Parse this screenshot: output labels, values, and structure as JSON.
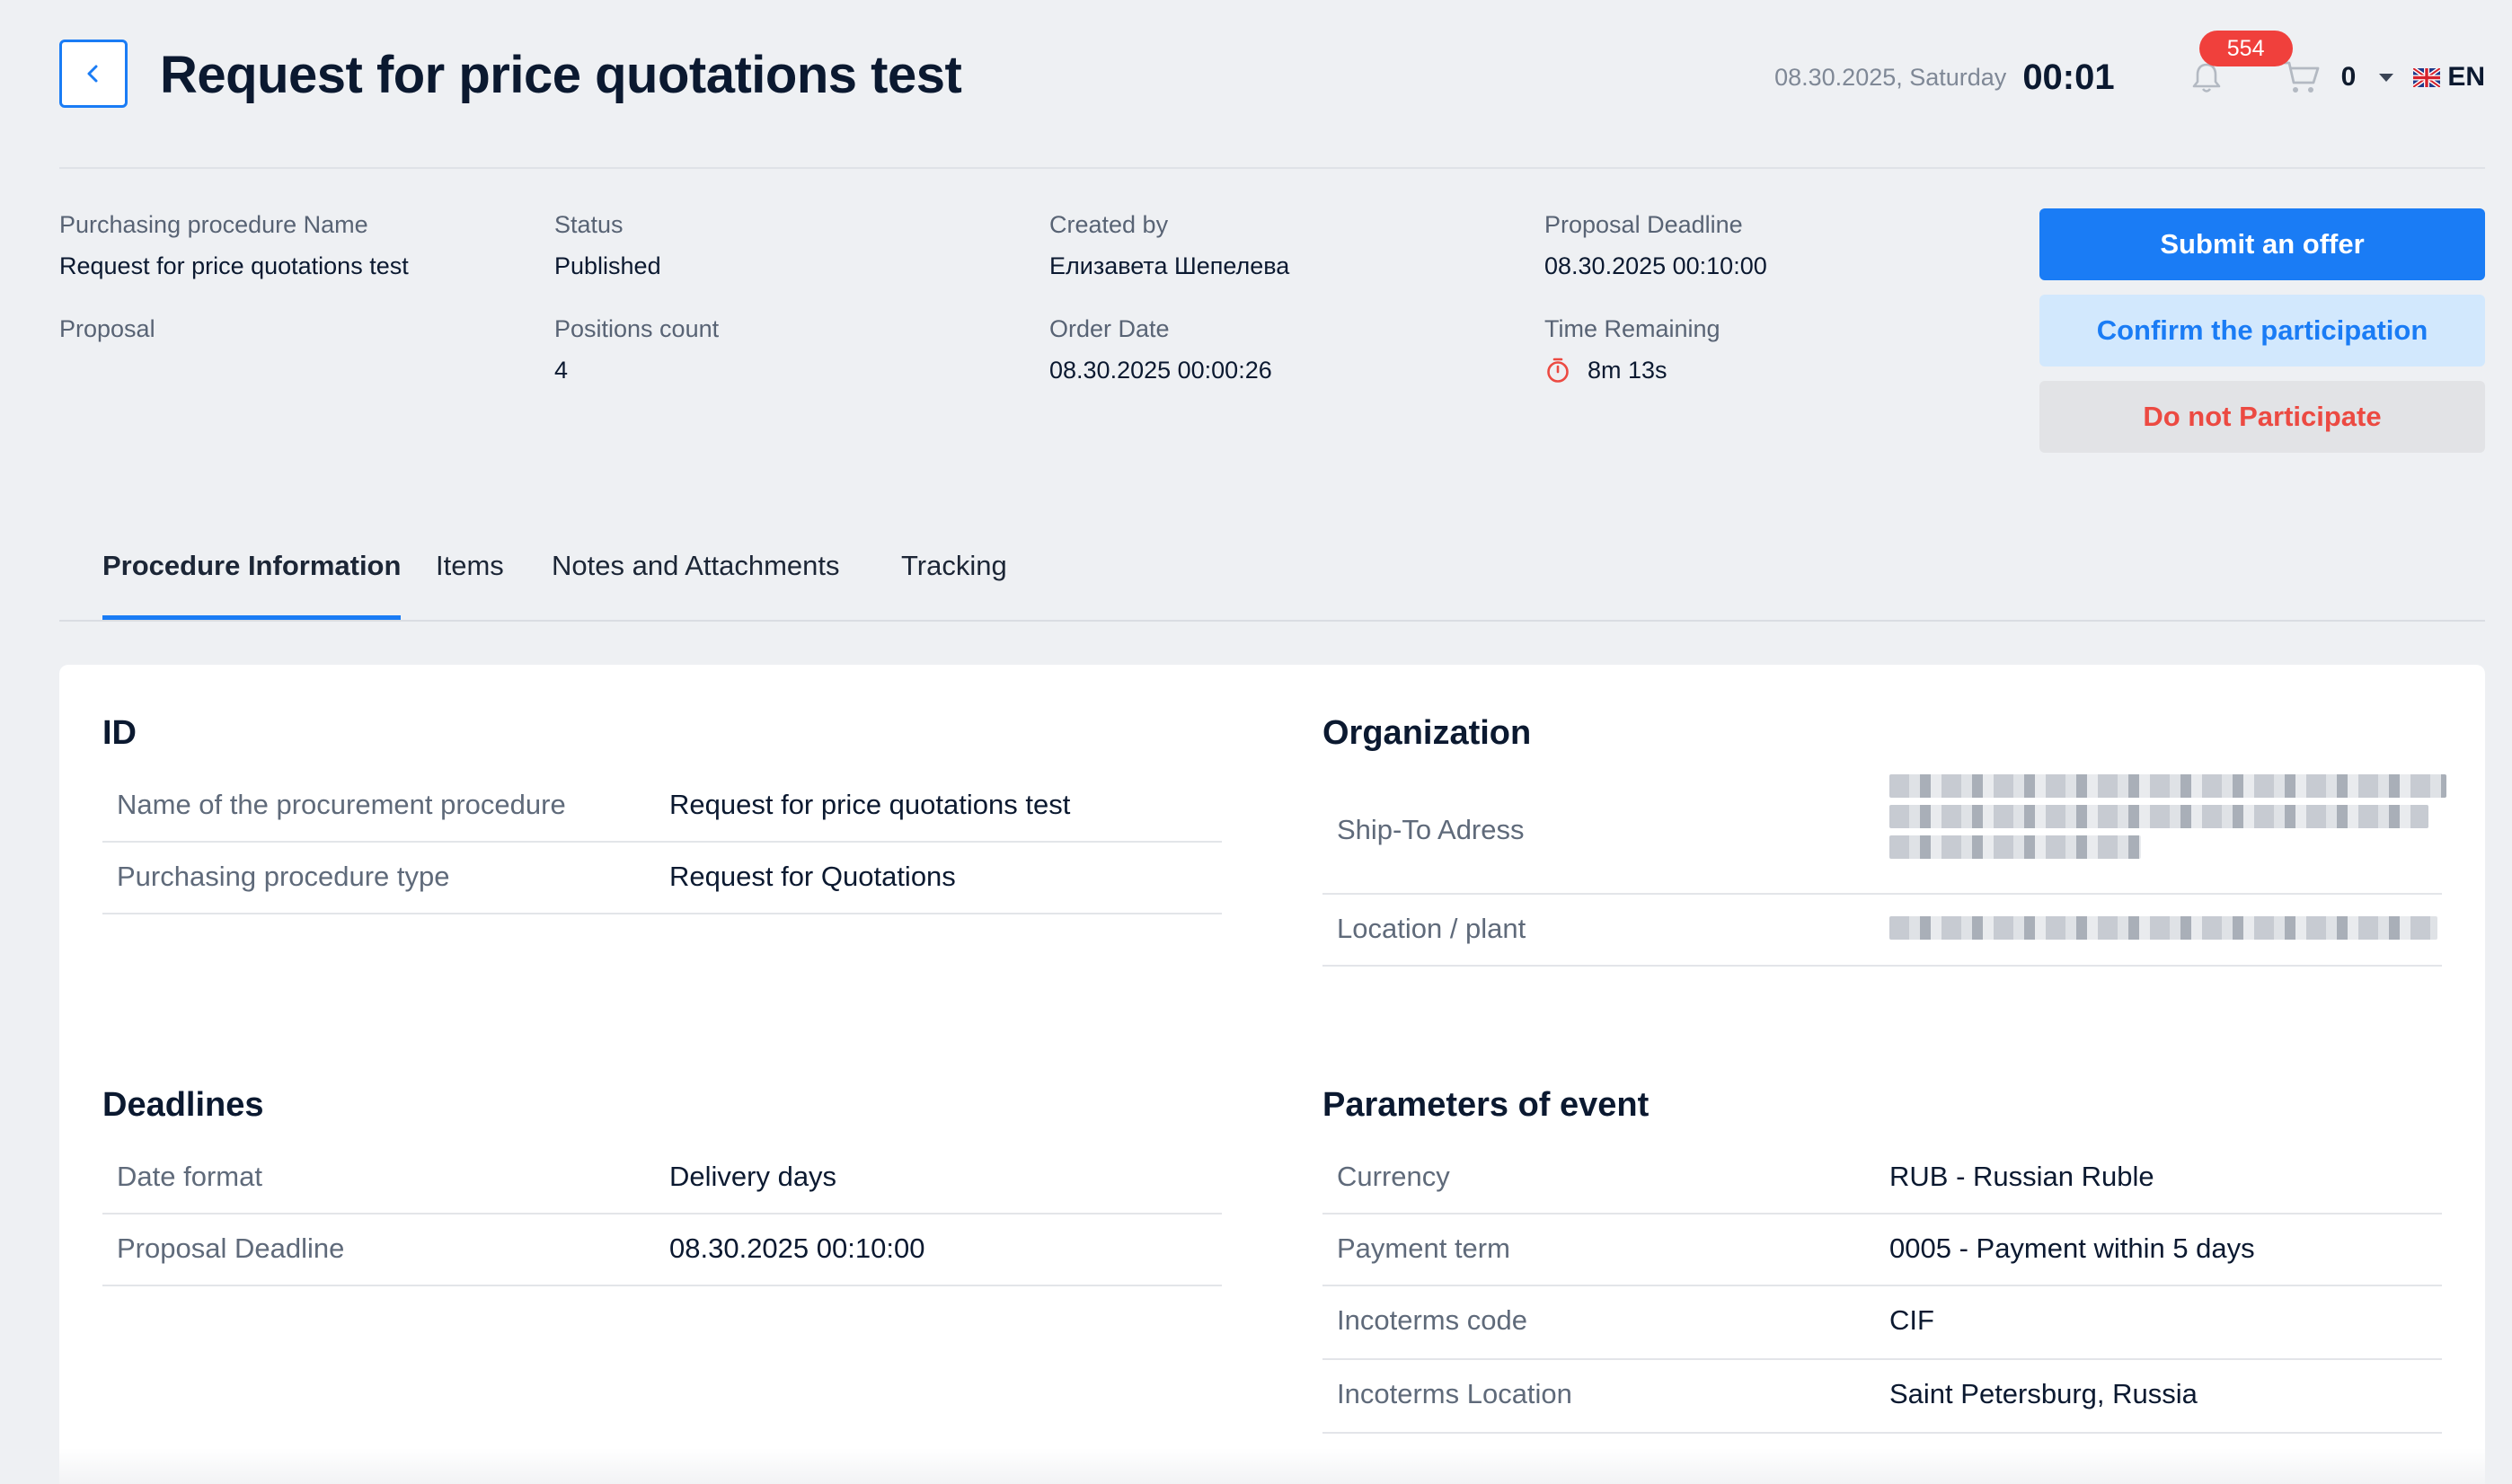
{
  "header": {
    "title": "Request for price quotations test",
    "date": "08.30.2025, Saturday",
    "time": "00:01",
    "notifications_count": "554",
    "cart_count": "0",
    "language": "EN"
  },
  "summary": {
    "procedure_name_label": "Purchasing procedure Name",
    "procedure_name_value": "Request for price quotations test",
    "status_label": "Status",
    "status_value": "Published",
    "created_by_label": "Created by",
    "created_by_value": "Елизавета Шепелева",
    "proposal_deadline_label": "Proposal Deadline",
    "proposal_deadline_value": "08.30.2025 00:10:00",
    "proposal_label": "Proposal",
    "positions_count_label": "Positions count",
    "positions_count_value": "4",
    "order_date_label": "Order Date",
    "order_date_value": "08.30.2025 00:00:26",
    "time_remaining_label": "Time Remaining",
    "time_remaining_value": "8m 13s"
  },
  "actions": {
    "submit_offer": "Submit an offer",
    "confirm_participation": "Confirm the participation",
    "do_not_participate": "Do not Participate"
  },
  "tabs": [
    {
      "label": "Procedure Information",
      "active": true
    },
    {
      "label": "Items",
      "active": false
    },
    {
      "label": "Notes and Attachments",
      "active": false
    },
    {
      "label": "Tracking",
      "active": false
    }
  ],
  "sections": {
    "id": {
      "title": "ID",
      "rows": [
        {
          "label": "Name of the procurement procedure",
          "value": "Request for price quotations test"
        },
        {
          "label": "Purchasing procedure type",
          "value": "Request for Quotations"
        }
      ]
    },
    "organization": {
      "title": "Organization",
      "rows": [
        {
          "label": "Ship-To Adress",
          "value": ""
        },
        {
          "label": "Location / plant",
          "value": ""
        }
      ]
    },
    "deadlines": {
      "title": "Deadlines",
      "rows": [
        {
          "label": "Date format",
          "value": "Delivery days"
        },
        {
          "label": "Proposal Deadline",
          "value": "08.30.2025 00:10:00"
        }
      ]
    },
    "parameters": {
      "title": "Parameters of event",
      "rows": [
        {
          "label": "Currency",
          "value": "RUB - Russian Ruble"
        },
        {
          "label": "Payment term",
          "value": "0005 - Payment within 5 days"
        },
        {
          "label": "Incoterms code",
          "value": "CIF"
        },
        {
          "label": "Incoterms Location",
          "value": "Saint Petersburg, Russia"
        }
      ]
    }
  },
  "colors": {
    "accent": "#1a7cf5",
    "danger": "#ec4a42",
    "badge": "#f0403c",
    "background": "#eef0f3"
  },
  "icons": [
    "chevron-left-icon",
    "bell-icon",
    "cart-icon",
    "caret-down-icon",
    "uk-flag-icon",
    "stopwatch-icon"
  ]
}
